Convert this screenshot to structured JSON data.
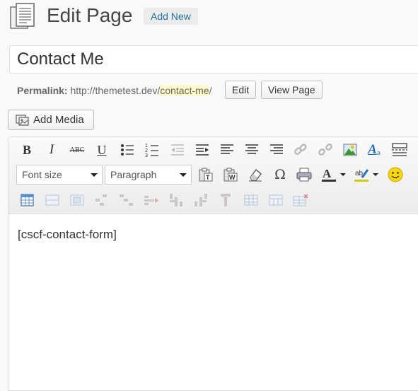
{
  "header": {
    "title": "Edit Page",
    "add_new_label": "Add New"
  },
  "post": {
    "title": "Contact Me"
  },
  "permalink": {
    "label": "Permalink:",
    "base_url": "http://themetest.dev/",
    "slug": "contact-me",
    "trailing": "/",
    "edit_label": "Edit",
    "view_label": "View Page"
  },
  "media": {
    "add_media_label": "Add Media"
  },
  "toolbar": {
    "font_size_label": "Font size",
    "format_label": "Paragraph",
    "icons_row1": [
      "bold-icon",
      "italic-icon",
      "strikethrough-icon",
      "underline-icon",
      "bullet-list-icon",
      "numbered-list-icon",
      "outdent-icon",
      "indent-icon",
      "align-left-icon",
      "align-center-icon",
      "align-right-icon",
      "insert-link-icon",
      "unlink-icon",
      "insert-image-icon",
      "styles-icon",
      "read-more-icon"
    ],
    "icons_row2": [
      "paste-text-icon",
      "paste-word-icon",
      "clear-formatting-icon",
      "special-character-icon",
      "print-icon",
      "text-color-icon",
      "highlight-color-icon",
      "emoticon-icon"
    ],
    "icons_row3": [
      "insert-table-icon",
      "table-row-icon",
      "table-cell-icon",
      "insert-row-before-icon",
      "insert-row-after-icon",
      "delete-row-icon",
      "insert-column-before-icon",
      "insert-column-after-icon",
      "delete-column-icon",
      "split-cells-icon",
      "merge-cells-icon",
      "table-props-icon"
    ],
    "colors": {
      "text_color": "#333333",
      "highlight_color": "#ffff00",
      "accent": "#21759b"
    }
  },
  "editor": {
    "content": "[cscf-contact-form]"
  }
}
